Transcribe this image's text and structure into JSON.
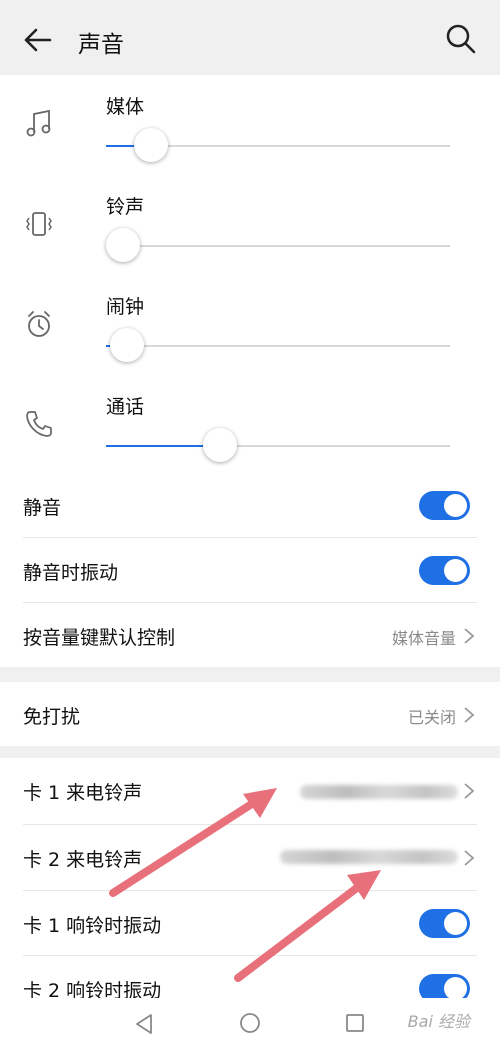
{
  "header": {
    "title": "声音",
    "back_icon": "back-arrow-icon",
    "search_icon": "search-icon"
  },
  "accent_color": "#1f6fe5",
  "volumes": [
    {
      "label": "媒体",
      "icon": "music-note-icon",
      "level": 0.13
    },
    {
      "label": "铃声",
      "icon": "vibrate-icon",
      "level": 0.0
    },
    {
      "label": "闹钟",
      "icon": "alarm-clock-icon",
      "level": 0.06
    },
    {
      "label": "通话",
      "icon": "phone-icon",
      "level": 0.33
    }
  ],
  "settings": {
    "mute": {
      "label": "静音",
      "on": true
    },
    "vibrate_on_mute": {
      "label": "静音时振动",
      "on": true
    },
    "volume_key": {
      "label": "按音量键默认控制",
      "value": "媒体音量"
    },
    "dnd": {
      "label": "免打扰",
      "value": "已关闭"
    },
    "sim1_ringtone": {
      "label": "卡 1 来电铃声"
    },
    "sim2_ringtone": {
      "label": "卡 2 来电铃声"
    },
    "sim1_vibrate": {
      "label": "卡 1 响铃时振动",
      "on": true
    },
    "sim2_vibrate": {
      "label": "卡 2 响铃时振动",
      "on": true
    }
  },
  "annotation_color": "#e8707a",
  "navbar": {
    "back_icon": "nav-back-icon",
    "home_icon": "nav-home-icon",
    "recents_icon": "nav-recents-icon"
  },
  "watermark": "Bai 经验"
}
